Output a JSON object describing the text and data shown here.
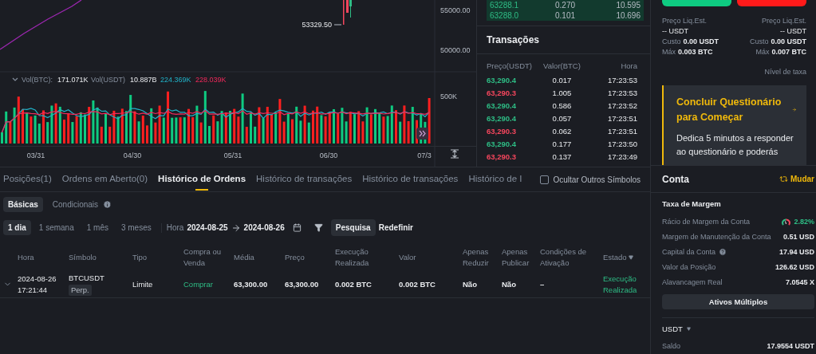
{
  "chart": {
    "price_labels": [
      "55000.00",
      "50000.00"
    ],
    "last_marker": "53329.50",
    "legend": {
      "label_1": "Vol(BTC):",
      "value_1": "171.071K",
      "label_2": "Vol(USDT)",
      "value_2": "10.887B",
      "ma_1": "224.369K",
      "ma_2": "228.039K"
    },
    "volume_label": "500K",
    "dates": [
      "03/31",
      "04/30",
      "05/31",
      "06/30",
      "07/3"
    ]
  },
  "order_book": {
    "rows": [
      {
        "price": "63288.1",
        "amount": "0.270",
        "total": "10.595"
      },
      {
        "price": "63288.0",
        "amount": "0.101",
        "total": "10.696"
      }
    ]
  },
  "trades": {
    "title": "Transações",
    "columns": [
      "Preço(USDT)",
      "Valor(BTC)",
      "Hora"
    ],
    "rows": [
      {
        "price": "63,290.4",
        "amount": "0.017",
        "time": "17:23:53",
        "color": "#2ebd85"
      },
      {
        "price": "63,290.3",
        "amount": "1.005",
        "time": "17:23:53",
        "color": "#f6465d"
      },
      {
        "price": "63,290.4",
        "amount": "0.586",
        "time": "17:23:52",
        "color": "#2ebd85"
      },
      {
        "price": "63,290.4",
        "amount": "0.057",
        "time": "17:23:51",
        "color": "#2ebd85"
      },
      {
        "price": "63,290.3",
        "amount": "0.062",
        "time": "17:23:51",
        "color": "#f6465d"
      },
      {
        "price": "63,290.4",
        "amount": "0.177",
        "time": "17:23:50",
        "color": "#2ebd85"
      },
      {
        "price": "63,290.3",
        "amount": "0.137",
        "time": "17:23:49",
        "color": "#f6465d"
      }
    ]
  },
  "order_form": {
    "columns": [
      {
        "liq_label": "Preço Liq.Est.",
        "liq_value": "-- USDT",
        "cost_label": "Custo",
        "cost_value": "0.00 USDT",
        "max_label": "Máx",
        "max_value": "0.003 BTC"
      },
      {
        "liq_label": "Preço Liq.Est.",
        "liq_value": "-- USDT",
        "cost_label": "Custo",
        "cost_value": "0.00 USDT",
        "max_label": "Máx",
        "max_value": "0.007 BTC"
      }
    ],
    "fee_level": "Nível de taxa",
    "banner": {
      "title": "Concluir Questionário para Começar",
      "body": "Dedica 5 minutos a responder ao questionário e poderás"
    }
  },
  "account": {
    "title": "Conta",
    "switch": "Mudar",
    "section": "Taxa de Margem",
    "rows": [
      {
        "label": "Rácio de Margem da Conta",
        "value": "2.82%",
        "kind": "ratio"
      },
      {
        "label": "Margem de Manutenção da Conta",
        "value": "0.51 USD",
        "kind": "plain"
      },
      {
        "label": "Capital da Conta",
        "value": "17.94 USD",
        "kind": "help"
      },
      {
        "label": "Valor da Posição",
        "value": "126.62 USD",
        "kind": "plain"
      },
      {
        "label": "Alavancagem Real",
        "value": "7.0545 X",
        "kind": "plain"
      }
    ],
    "button": "Ativos Múltiplos",
    "asset": "USDT",
    "balance_label": "Saldo",
    "balance_value": "17.9554 USDT"
  },
  "orders": {
    "tabs": [
      {
        "label": "Posições(1)",
        "selected": false
      },
      {
        "label": "Ordens em Aberto(0)",
        "selected": false
      },
      {
        "label": "Histórico de Ordens",
        "selected": true
      },
      {
        "label": "Histórico de transações",
        "selected": false
      },
      {
        "label": "Histórico de transações",
        "selected": false
      },
      {
        "label": "Histórico de I",
        "selected": false
      }
    ],
    "hide_others": {
      "label": "Ocultar Outros Símbolos",
      "checked": false
    },
    "subtabs": [
      {
        "label": "Básicas",
        "selected": true
      },
      {
        "label": "Condicionais",
        "selected": false
      }
    ],
    "periods": [
      {
        "label": "1 dia",
        "selected": true
      },
      {
        "label": "1 semana",
        "selected": false
      },
      {
        "label": "1 mês",
        "selected": false
      },
      {
        "label": "3 meses",
        "selected": false
      }
    ],
    "time_label": "Hora",
    "date_from": "2024-08-25",
    "date_to": "2024-08-26",
    "search_button": "Pesquisa",
    "reset_button": "Redefinir",
    "columns": [
      "Hora",
      "Símbolo",
      "Tipo",
      "Compra ou Venda",
      "Média",
      "Preço",
      "Execução Realizada",
      "Valor",
      "Apenas Reduzir",
      "Apenas Publicar",
      "Condições de Ativação",
      "Estado"
    ],
    "rows": [
      {
        "date": "2024-08-26",
        "time": "17:21:44",
        "symbol": "BTCUSDT",
        "tag": "Perp.",
        "type": "Limite",
        "side": "Comprar",
        "average": "63,300.00",
        "price": "63,300.00",
        "filled": "0.002 BTC",
        "amount": "0.002 BTC",
        "reduce_only": "Não",
        "post_only": "Não",
        "trigger": "–",
        "status": "Execução Realizada"
      }
    ]
  }
}
